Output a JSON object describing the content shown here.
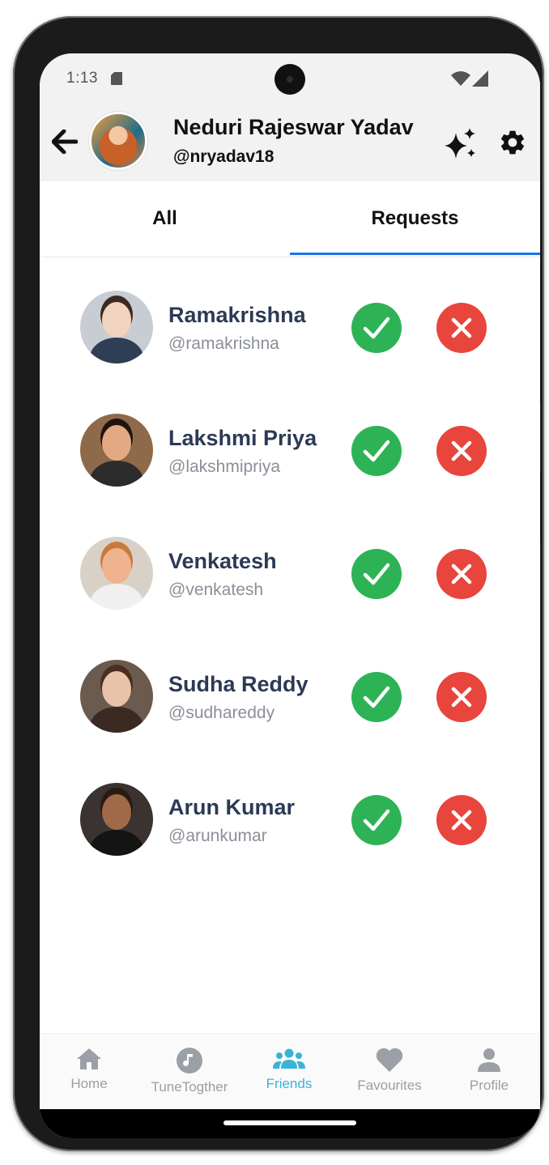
{
  "status_bar": {
    "time": "1:13"
  },
  "header": {
    "name": "Neduri Rajeswar Yadav",
    "handle": "@nryadav18",
    "back_icon": "arrow-left-icon",
    "sparkle_icon": "sparkles-icon",
    "settings_icon": "gear-icon"
  },
  "tabs": [
    {
      "label": "All",
      "active": false
    },
    {
      "label": "Requests",
      "active": true
    }
  ],
  "requests": [
    {
      "name": "Ramakrishna",
      "handle": "@ramakrishna",
      "skin": "#f2d3bf",
      "hair": "#3a2a22",
      "shirt": "#2f3e55",
      "bg": "#c8ccd3"
    },
    {
      "name": "Lakshmi Priya",
      "handle": "@lakshmipriya",
      "skin": "#e3a983",
      "hair": "#1e1410",
      "shirt": "#2c2c2c",
      "bg": "#8f6a4a"
    },
    {
      "name": "Venkatesh",
      "handle": "@venkatesh",
      "skin": "#efb38f",
      "hair": "#c87a3c",
      "shirt": "#f0f0f0",
      "bg": "#d9d1c8"
    },
    {
      "name": "Sudha Reddy",
      "handle": "@sudhareddy",
      "skin": "#e9c3a9",
      "hair": "#4a2e1f",
      "shirt": "#3b2a22",
      "bg": "#6b5a4e"
    },
    {
      "name": "Arun Kumar",
      "handle": "@arunkumar",
      "skin": "#a06a48",
      "hair": "#2a1b12",
      "shirt": "#141414",
      "bg": "#3a3330"
    }
  ],
  "nav": [
    {
      "label": "Home",
      "icon": "home-icon",
      "active": false
    },
    {
      "label": "TuneTogther",
      "icon": "music-note-icon",
      "active": false
    },
    {
      "label": "Friends",
      "icon": "friends-icon",
      "active": true
    },
    {
      "label": "Favourites",
      "icon": "heart-icon",
      "active": false
    },
    {
      "label": "Profile",
      "icon": "person-icon",
      "active": false
    }
  ],
  "colors": {
    "accept": "#2db356",
    "reject": "#e8453c",
    "active_tab": "#1a73e8",
    "nav_active": "#3ab4d6",
    "nav_inactive": "#9aa0a6"
  }
}
